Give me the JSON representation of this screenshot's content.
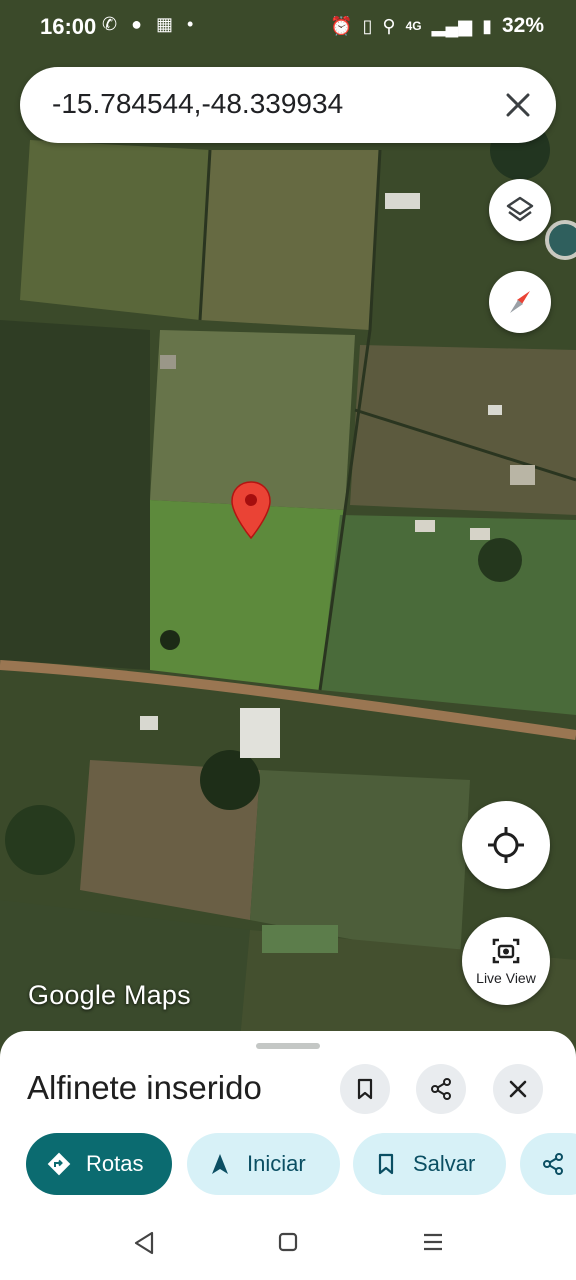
{
  "status_bar": {
    "time": "16:00",
    "battery": "32%",
    "network": "4G"
  },
  "search": {
    "query": "-15.784544,-48.339934"
  },
  "map": {
    "attribution": "Google Maps",
    "live_view_label": "Live View",
    "pin_color": "#ea4335"
  },
  "place_sheet": {
    "title": "Alfinete inserido",
    "actions": [
      {
        "label": "Rotas",
        "icon": "directions-icon"
      },
      {
        "label": "Iniciar",
        "icon": "navigation-arrow-icon"
      },
      {
        "label": "Salvar",
        "icon": "bookmark-icon"
      },
      {
        "label": "",
        "icon": "share-icon"
      }
    ]
  },
  "colors": {
    "primary_chip": "#0b6b70",
    "secondary_chip": "#d7f1f7"
  }
}
